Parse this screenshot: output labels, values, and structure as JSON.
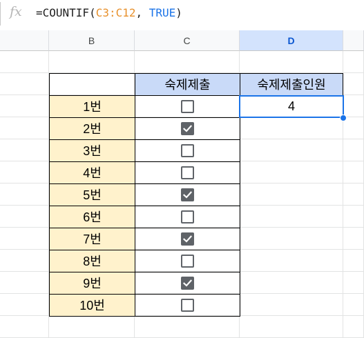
{
  "formula_bar": {
    "icon": "fx-icon",
    "formula_prefix": "=COUNTIF(",
    "formula_range": "C3:C12",
    "formula_sep": ", ",
    "formula_bool": "TRUE",
    "formula_suffix": ")"
  },
  "columns": [
    "B",
    "C",
    "D"
  ],
  "selected_column": "D",
  "table": {
    "header_c": "숙제제출",
    "header_d": "숙제제출인원",
    "result": "4",
    "rows": [
      {
        "label": "1번",
        "checked": false
      },
      {
        "label": "2번",
        "checked": true
      },
      {
        "label": "3번",
        "checked": false
      },
      {
        "label": "4번",
        "checked": false
      },
      {
        "label": "5번",
        "checked": true
      },
      {
        "label": "6번",
        "checked": false
      },
      {
        "label": "7번",
        "checked": true
      },
      {
        "label": "8번",
        "checked": false
      },
      {
        "label": "9번",
        "checked": true
      },
      {
        "label": "10번",
        "checked": false
      }
    ]
  },
  "colors": {
    "header_fill": "#c9daf8",
    "label_fill": "#fff2cc",
    "selection": "#1a73e8"
  }
}
